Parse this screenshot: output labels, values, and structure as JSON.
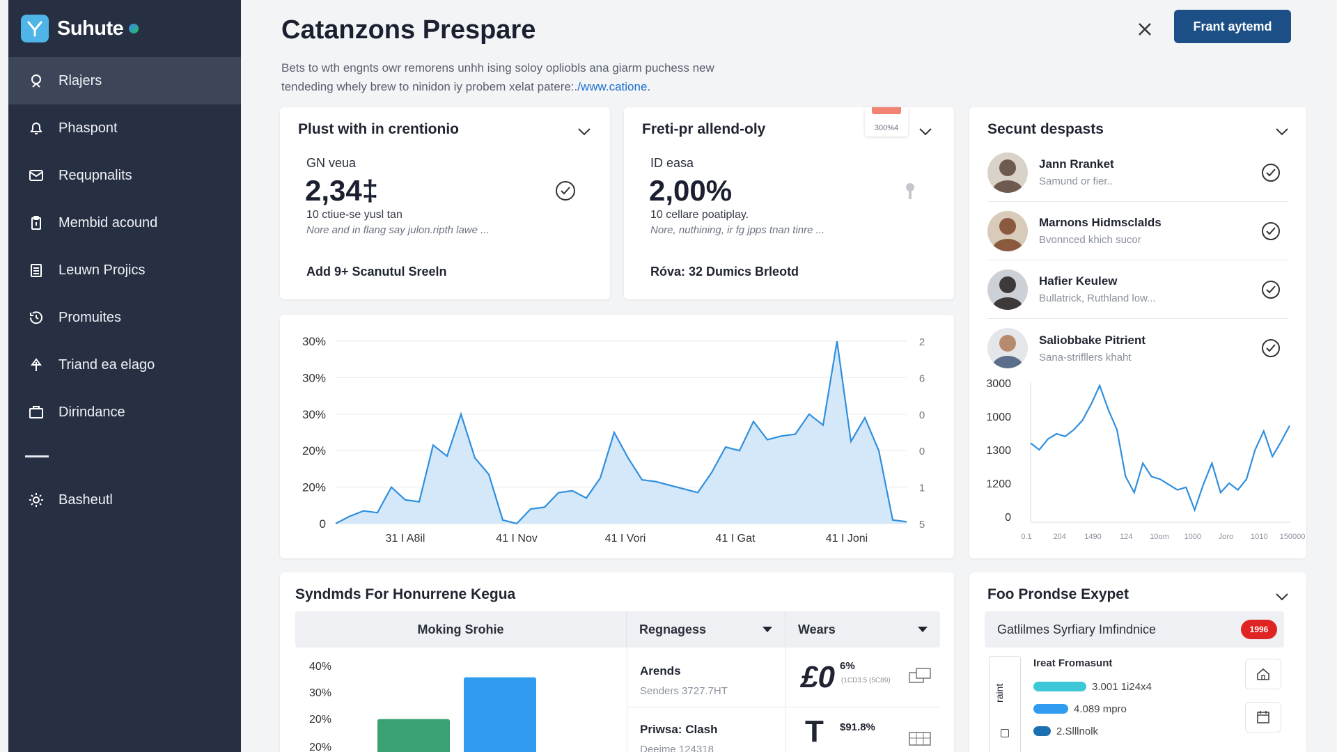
{
  "app": {
    "name": "Suhute"
  },
  "sidebar": {
    "items": [
      {
        "label": "Rlajers",
        "icon": "search-icon",
        "active": true
      },
      {
        "label": "Phaspont",
        "icon": "bell-icon"
      },
      {
        "label": "Requpnalits",
        "icon": "mail-icon"
      },
      {
        "label": "Membid acound",
        "icon": "clipboard-icon"
      },
      {
        "label": "Leuwn Projics",
        "icon": "document-icon"
      },
      {
        "label": "Promuites",
        "icon": "history-icon"
      },
      {
        "label": "Triand ea elago",
        "icon": "upload-icon"
      },
      {
        "label": "Dirindance",
        "icon": "folder-icon"
      }
    ],
    "settings": {
      "label": "Basheutl",
      "icon": "gear-icon"
    }
  },
  "header": {
    "title": "Catanzons Prespare",
    "description_line1": "Bets to wth engnts owr remorens unhh ising soloy opliobls ana giarm puchess new",
    "description_line2": "tendeding whely brew to ninidon iy probem xelat patere:.",
    "link": "/www.catione",
    "link_suffix": ".",
    "primary_button": "Frant aytemd"
  },
  "kpi_cards": [
    {
      "title": "Plust with in crentionio",
      "label": "GN veua",
      "value": "2,34‡",
      "sub": "10 ctiue-se yusl tan",
      "note": "Nore and in flang say julon.ripth lawe ...",
      "footer": "Add 9+ Scanutul Sreeln"
    },
    {
      "title": "Freti-pr allend-oly",
      "label": "ID easa",
      "value": "2,00%",
      "sub": "10 cellare poatiplay.",
      "note": "Nore, nuthining, ir fg jpps tnan tinre ...",
      "footer": "Róva: 32 Dumics Brleotd",
      "tag": "300%4"
    }
  ],
  "main_chart": {
    "chart_data": {
      "type": "area",
      "categories": [
        "31 I A8il",
        "41 I Nov",
        "41 I Vori",
        "41 I Gat",
        "41 I Joni"
      ],
      "y_ticks_left": [
        "30%",
        "30%",
        "30%",
        "20%",
        "20%",
        "0"
      ],
      "y_ticks_right": [
        "2",
        "6",
        "0",
        "0",
        "1",
        "5"
      ],
      "ylim": [
        0,
        100
      ],
      "values": [
        0,
        4,
        7,
        6,
        20,
        13,
        12,
        43,
        37,
        60,
        36,
        27,
        2,
        0,
        8,
        9,
        17,
        18,
        14,
        25,
        50,
        36,
        24,
        23,
        21,
        19,
        17,
        28,
        42,
        40,
        56,
        46,
        48,
        49,
        60,
        54,
        100,
        45,
        58,
        40,
        2,
        1
      ],
      "grid": true,
      "color": "#2f8fde"
    }
  },
  "recent_panel": {
    "title": "Secunt despasts",
    "people": [
      {
        "name": "Jann Rranket",
        "sub": "Samund or fier..",
        "avatar": "#6f5a4f"
      },
      {
        "name": "Marnons Hidmsclalds",
        "sub": "Bvonnced khich sucor",
        "avatar": "#8a5a3e"
      },
      {
        "name": "Hafier Keulew",
        "sub": "Bullatrick, Ruthland low...",
        "avatar": "#3e3a3a"
      },
      {
        "name": "Saliobbake Pitrient",
        "sub": "Sana-strifllers khaht",
        "avatar": "#b78a6f"
      }
    ],
    "chart_data": {
      "type": "line",
      "y_ticks": [
        "3000",
        "1000",
        "1300",
        "1200",
        "0"
      ],
      "x_ticks": [
        "0.1",
        "204",
        "1490",
        "124",
        "10om",
        "1000",
        "Joro",
        "1010",
        "150000"
      ],
      "ylim": [
        0,
        100
      ],
      "values": [
        55,
        50,
        58,
        62,
        60,
        65,
        72,
        84,
        98,
        80,
        65,
        30,
        18,
        40,
        30,
        28,
        24,
        20,
        22,
        5,
        24,
        40,
        18,
        25,
        20,
        28,
        50,
        64,
        45,
        56,
        68
      ],
      "color": "#2f8fde"
    }
  },
  "table_card": {
    "title": "Syndmds For Honurrene Kegua",
    "columns": [
      "Moking Srohie",
      "Regnagess",
      "Wears"
    ],
    "bar_chart": {
      "chart_data": {
        "type": "bar",
        "y_ticks": [
          "40%",
          "30%",
          "20%",
          "20%"
        ],
        "values": [
          28,
          53
        ],
        "colors": [
          "#3aa172",
          "#2f9cf0"
        ]
      }
    },
    "rows": [
      {
        "name": "Arends",
        "sub": "Senders 3727.7HT",
        "metric_main": "£0",
        "metric_sup": "6%",
        "metric_small": "(1CD3.5 (5C89)"
      },
      {
        "name": "Priwsa: Clash",
        "sub": "Deeime 124318",
        "metric_main": "T",
        "metric_sup": "$91.8%"
      }
    ]
  },
  "found_card": {
    "title": "Foo Prondse Exypet",
    "alert_label": "Gatlilmes Syrfiary Imfindnice",
    "alert_badge": "1996",
    "side_label": "raint",
    "legend_title": "Ireat Fromasunt",
    "legend": [
      {
        "label": "3.001 1i24x4",
        "color": "#3ec7d6",
        "fill": 0.9
      },
      {
        "label": "4.089 mpro",
        "color": "#2f9cf0",
        "fill": 0.6
      },
      {
        "label": "2.Slllnolk",
        "color": "#1c6fb0",
        "fill": 0.3
      }
    ]
  }
}
